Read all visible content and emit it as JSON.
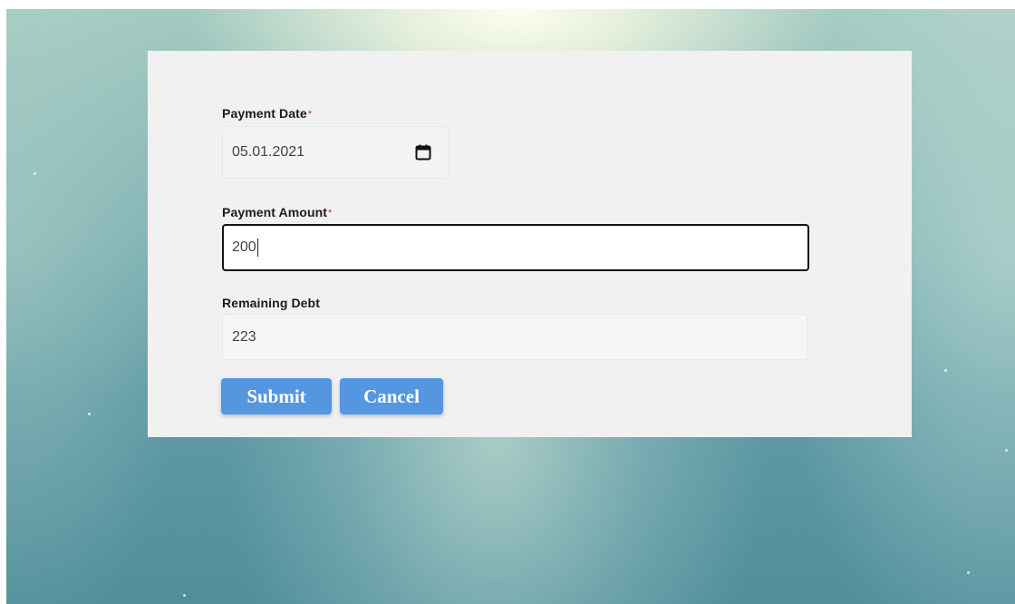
{
  "form": {
    "payment_date": {
      "label": "Payment Date",
      "required_marker": "*",
      "value": "05.01.2021"
    },
    "payment_amount": {
      "label": "Payment Amount",
      "required_marker": "*",
      "value": "200"
    },
    "remaining_debt": {
      "label": "Remaining Debt",
      "value": "223"
    },
    "buttons": {
      "submit_label": "Submit",
      "cancel_label": "Cancel"
    }
  },
  "colors": {
    "button_bg": "#5596e0",
    "required_marker": "#d22a2a",
    "card_bg": "#f1f1f1",
    "focused_border": "#151515"
  },
  "icons": {
    "date_picker": "calendar-icon"
  }
}
